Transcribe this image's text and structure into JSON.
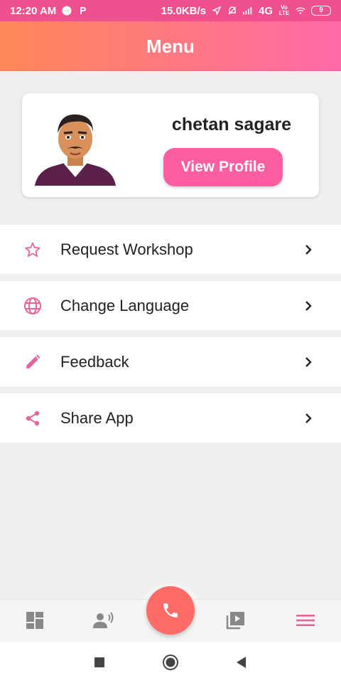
{
  "status_bar": {
    "time": "12:20 AM",
    "speed": "15.0KB/s",
    "network": "4G",
    "volte": "Vo LTE",
    "battery": "9"
  },
  "header": {
    "title": "Menu"
  },
  "profile": {
    "name": "chetan sagare",
    "view_profile_label": "View Profile"
  },
  "menu": {
    "items": [
      {
        "label": "Request Workshop",
        "icon": "star-outline-icon"
      },
      {
        "label": "Change Language",
        "icon": "globe-icon"
      },
      {
        "label": "Feedback",
        "icon": "pencil-icon"
      },
      {
        "label": "Share App",
        "icon": "share-icon"
      }
    ]
  },
  "bottom_nav": {
    "items": [
      "dashboard-icon",
      "voice-icon",
      "call-icon",
      "video-library-icon",
      "menu-icon"
    ],
    "active": "menu-icon"
  },
  "colors": {
    "accent": "#ff5fa0",
    "header_start": "#ff8859",
    "header_end": "#ff6aa7",
    "call": "#ff6b67",
    "icon": "#e5649a"
  }
}
